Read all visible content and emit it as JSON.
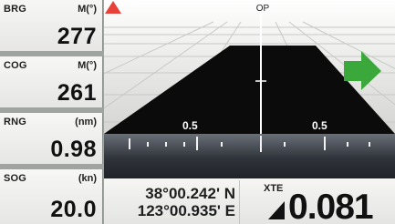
{
  "data_boxes": [
    {
      "label": "BRG",
      "unit": "M(°)",
      "value": "277"
    },
    {
      "label": "COG",
      "unit": "M(°)",
      "value": "261"
    },
    {
      "label": "RNG",
      "unit": "(nm)",
      "value": "0.98"
    },
    {
      "label": "SOG",
      "unit": "(kn)",
      "value": "20.0"
    }
  ],
  "highway": {
    "destination_label": "OP",
    "scale_left": "0.5",
    "scale_right": "0.5",
    "arrow_color": "#3aa83a",
    "marker_color": "#e8413a",
    "steer_arrow_icon": "green-right-arrow",
    "boat_marker_icon": "red-triangle"
  },
  "position": {
    "latitude": "38°00.242' N",
    "longitude": "123°00.935' E"
  },
  "xte": {
    "label": "XTE",
    "direction_icon": "arrow-left-icon",
    "value": "0.081"
  }
}
